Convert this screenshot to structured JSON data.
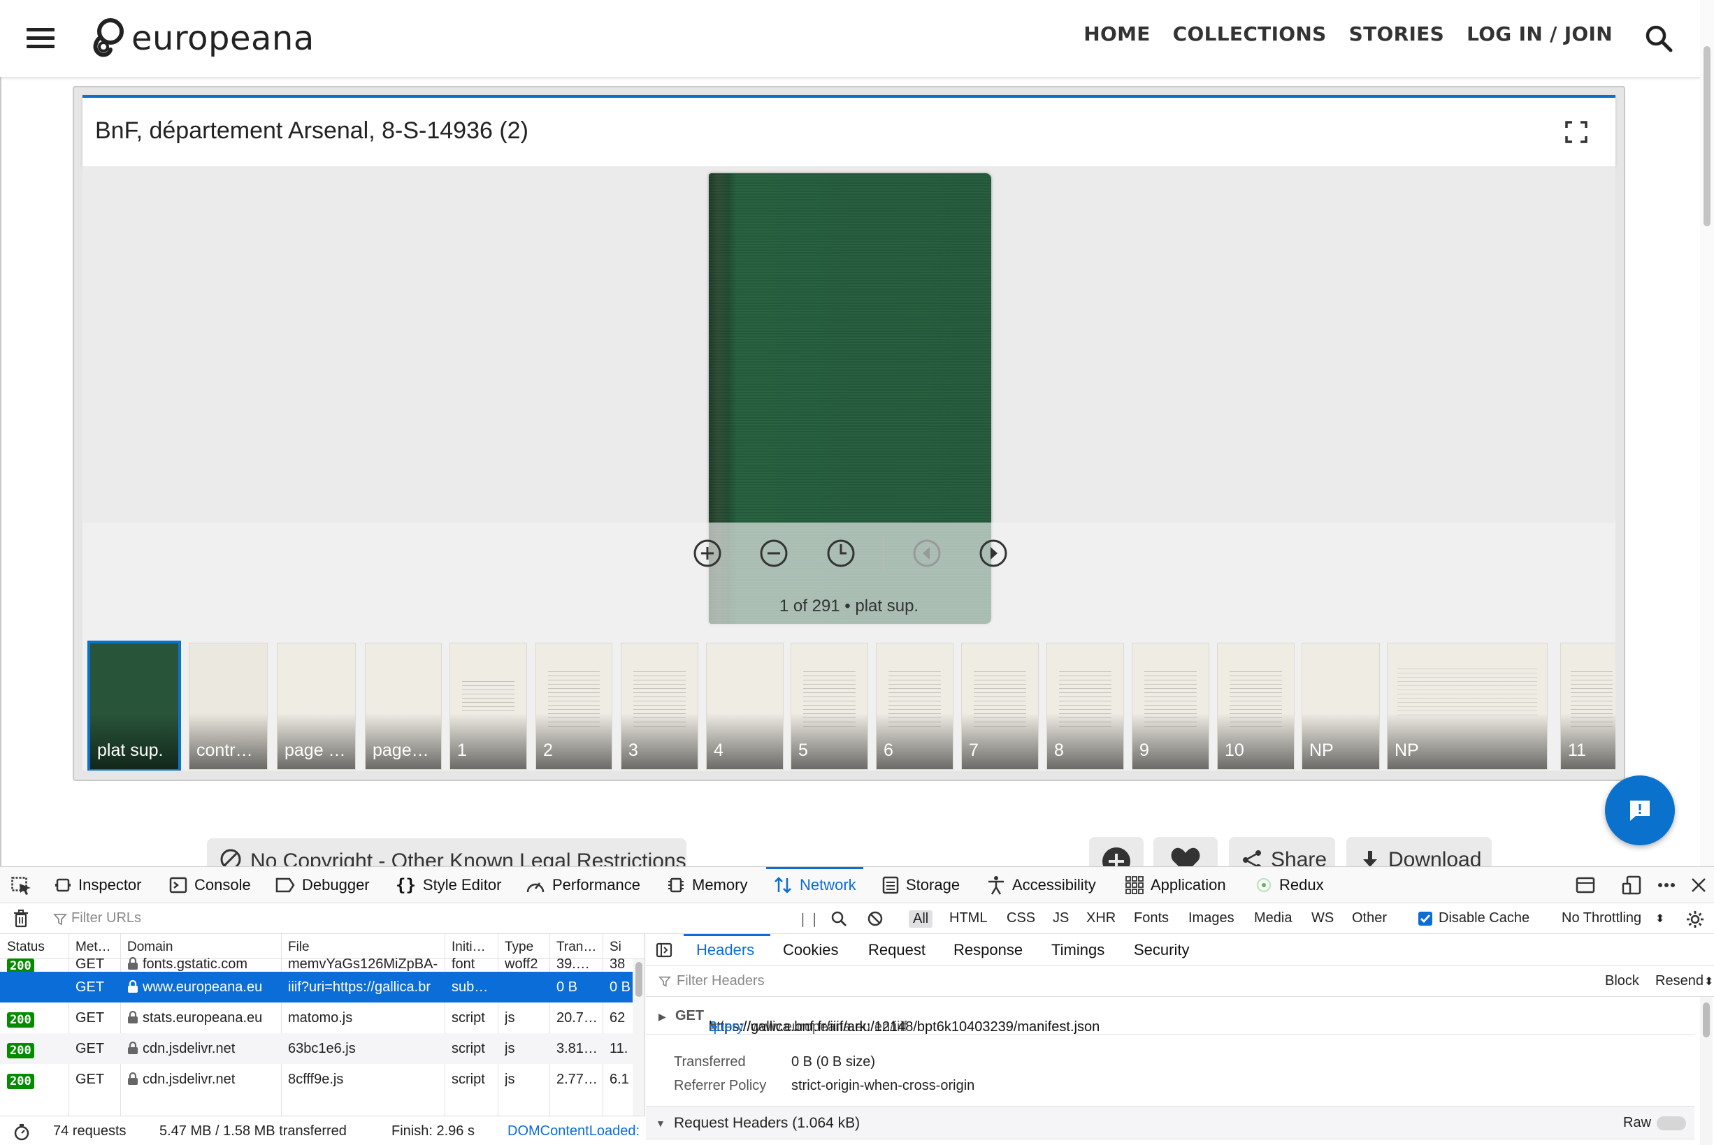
{
  "site": {
    "logo_text": "europeana",
    "nav": [
      "HOME",
      "COLLECTIONS",
      "STORIES",
      "LOG IN / JOIN"
    ],
    "brand_color": "#0a72cc"
  },
  "viewer": {
    "title": "BnF, département Arsenal, 8-S-14936 (2)",
    "page_info": "1 of 291 • plat sup.",
    "controls": [
      "zoom-in-icon",
      "zoom-out-icon",
      "reset-zoom-icon",
      "previous-page-icon",
      "next-page-icon"
    ],
    "thumbnails": [
      "plat sup.",
      "contr…",
      "page …",
      "page…",
      "1",
      "2",
      "3",
      "4",
      "5",
      "6",
      "7",
      "8",
      "9",
      "10",
      "NP",
      "NP",
      "11"
    ]
  },
  "item": {
    "rights": "No Copyright - Other Known Legal Restrictions",
    "share_label": "Share",
    "download_label": "Download"
  },
  "devtools": {
    "tabs": [
      "Inspector",
      "Console",
      "Debugger",
      "Style Editor",
      "Performance",
      "Memory",
      "Network",
      "Storage",
      "Accessibility",
      "Application",
      "Redux"
    ],
    "selected_tab": "Network",
    "filter_placeholder": "Filter URLs",
    "type_filters": [
      "All",
      "HTML",
      "CSS",
      "JS",
      "XHR",
      "Fonts",
      "Images",
      "Media",
      "WS",
      "Other"
    ],
    "disable_cache_label": "Disable Cache",
    "disable_cache_checked": true,
    "throttling": "No Throttling",
    "columns": [
      "Status",
      "Met…",
      "Domain",
      "File",
      "Initi…",
      "Type",
      "Tran…",
      "Si"
    ],
    "requests": [
      {
        "status": "200",
        "method": "GET",
        "domain": "fonts.gstatic.com",
        "file": "memvYaGs126MiZpBA-",
        "initiator": "font",
        "type": "woff2",
        "transferred": "39.…",
        "size": "38"
      },
      {
        "status": "",
        "method": "GET",
        "domain": "www.europeana.eu",
        "file": "iiif?uri=https://gallica.br",
        "initiator": "sub…",
        "type": "",
        "transferred": "0 B",
        "size": "0 B"
      },
      {
        "status": "200",
        "method": "GET",
        "domain": "stats.europeana.eu",
        "file": "matomo.js",
        "initiator": "script",
        "type": "js",
        "transferred": "20.7…",
        "size": "62"
      },
      {
        "status": "200",
        "method": "GET",
        "domain": "cdn.jsdelivr.net",
        "file": "63bc1e6.js",
        "initiator": "script",
        "type": "js",
        "transferred": "3.81…",
        "size": "11."
      },
      {
        "status": "200",
        "method": "GET",
        "domain": "cdn.jsdelivr.net",
        "file": "8cfff9e.js",
        "initiator": "script",
        "type": "js",
        "transferred": "2.77…",
        "size": "6.1"
      }
    ],
    "summary": {
      "requests": "74 requests",
      "transferred": "5.47 MB / 1.58 MB transferred",
      "finish": "Finish: 2.96 s",
      "dom": "DOMContentLoaded:"
    },
    "detail_tabs": [
      "Headers",
      "Cookies",
      "Request",
      "Response",
      "Timings",
      "Security"
    ],
    "filter_headers_placeholder": "Filter Headers",
    "block_label": "Block",
    "resend_label": "Resend",
    "request_line": {
      "method": "GET",
      "url_base": "https://www.europeana.eu/en/iiif",
      "q1": "?",
      "param1": "uri",
      "eq1": "=",
      "val1": "https://gallica.bnf.fr/iiif/ark:/12148/bpt6k10403239/manifest.json",
      "amp": "&",
      "param2": "query",
      "eq2": "="
    },
    "transferred_label": "Transferred",
    "transferred_value": "0 B (0 B size)",
    "referrer_label": "Referrer Policy",
    "referrer_value": "strict-origin-when-cross-origin",
    "request_headers": "Request Headers (1.064 kB)",
    "raw_label": "Raw"
  }
}
